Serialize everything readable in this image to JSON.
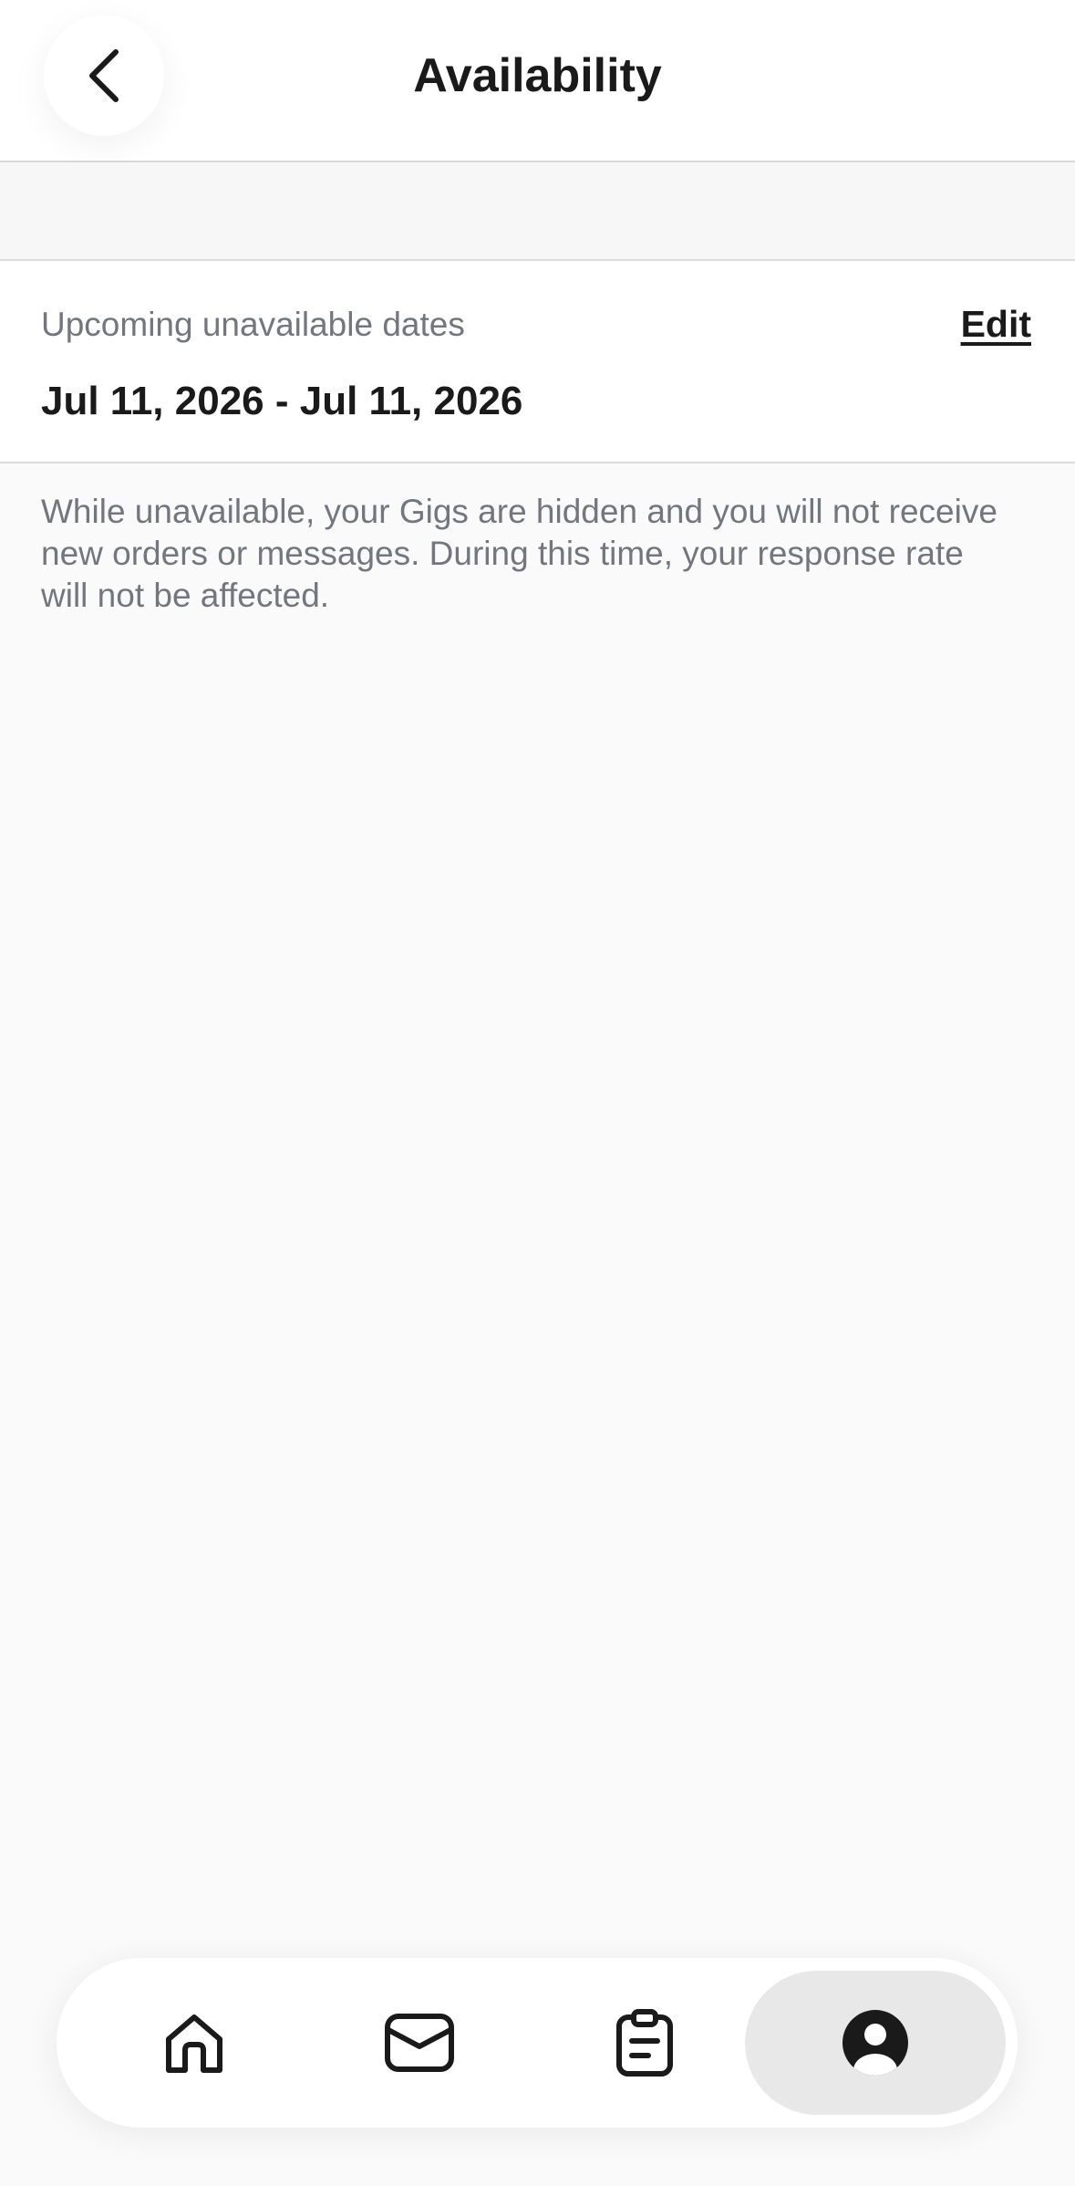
{
  "header": {
    "title": "Availability",
    "back_icon": "chevron-left-icon"
  },
  "unavailable": {
    "label": "Upcoming unavailable dates",
    "edit_label": "Edit",
    "date_range": "Jul 11, 2026 - Jul 11, 2026"
  },
  "info": {
    "text": "While unavailable, your Gigs are hidden and you will not receive new orders or messages. During this time, your response rate will not be affected."
  },
  "bottom_nav": {
    "items": [
      {
        "icon": "home-icon",
        "active": false
      },
      {
        "icon": "envelope-icon",
        "active": false
      },
      {
        "icon": "clipboard-icon",
        "active": false
      },
      {
        "icon": "profile-icon",
        "active": true
      }
    ]
  },
  "colors": {
    "text_primary": "#1a1a1a",
    "text_secondary": "#74767e",
    "background": "#fafafa",
    "active_tab": "#e8e8e8"
  }
}
